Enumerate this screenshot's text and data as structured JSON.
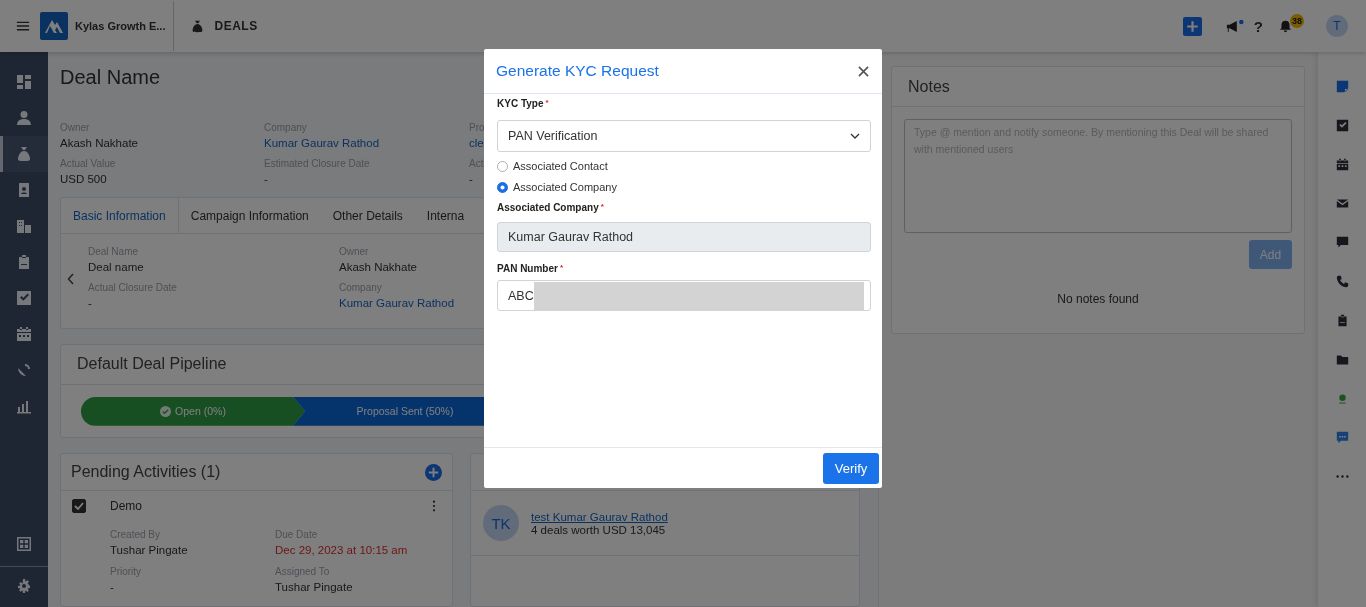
{
  "topbar": {
    "app_name": "Kylas Growth E...",
    "module": "DEALS",
    "announcement_unread": true,
    "help_label": "?",
    "notification_count": "38",
    "avatar_initial": "T"
  },
  "sidebar": {
    "items": [
      {
        "selected": false
      },
      {
        "selected": false
      },
      {
        "selected": true
      },
      {
        "selected": false
      },
      {
        "selected": false
      },
      {
        "selected": false
      },
      {
        "selected": false
      },
      {
        "selected": false
      },
      {
        "selected": false
      },
      {
        "selected": false
      }
    ]
  },
  "deal": {
    "title": "Deal Name",
    "fields": [
      {
        "label": "Owner",
        "value": "Akash Nakhate",
        "link": false
      },
      {
        "label": "Company",
        "value": "Kumar Gaurav Rathod",
        "link": true
      },
      {
        "label": "Pro",
        "value": "cle",
        "link": true
      },
      {
        "label": "Actual Value",
        "value": "USD 500",
        "link": false
      },
      {
        "label": "Estimated Closure Date",
        "value": "-",
        "link": false
      },
      {
        "label": "Act",
        "value": "-",
        "link": false
      }
    ]
  },
  "details": {
    "tabs": [
      {
        "label": "Basic Information",
        "selected": true
      },
      {
        "label": "Campaign Information",
        "selected": false
      },
      {
        "label": "Other Details",
        "selected": false
      },
      {
        "label": "Interna",
        "selected": false
      }
    ],
    "fields": [
      {
        "label": "Deal Name",
        "value": "Deal name",
        "link": false
      },
      {
        "label": "Owner",
        "value": "Akash Nakhate",
        "link": false
      },
      {
        "label": "Actual Closure Date",
        "value": "-",
        "link": false
      },
      {
        "label": "Company",
        "value": "Kumar Gaurav Rathod",
        "link": true
      }
    ]
  },
  "pipeline": {
    "title": "Default Deal Pipeline",
    "stages": [
      {
        "label": "Open (0%)",
        "done": true
      },
      {
        "label": "Proposal Sent (50%)",
        "done": false
      }
    ]
  },
  "activities": {
    "title": "Pending Activities (1)",
    "items": [
      {
        "title": "Demo",
        "checked": true,
        "fields": [
          {
            "label": "Created By",
            "value": "Tushar Pingate",
            "overdue": false
          },
          {
            "label": "Due Date",
            "value": "Dec 29, 2023 at 10:15 am",
            "overdue": true
          },
          {
            "label": "Priority",
            "value": "-",
            "overdue": false
          },
          {
            "label": "Assigned To",
            "value": "Tushar Pingate",
            "overdue": false
          }
        ]
      }
    ]
  },
  "contacts_card": {
    "items": [
      {
        "initials": "TK",
        "name": "test Kumar Gaurav Rathod",
        "summary": "4 deals worth USD 13,045"
      }
    ]
  },
  "notes": {
    "title": "Notes",
    "placeholder": "Type @ mention and notify someone. By mentioning this Deal will be shared with mentioned users",
    "add_label": "Add",
    "add_disabled": true,
    "empty_text": "No notes found"
  },
  "rail": {
    "items": [
      {
        "selected": true
      },
      {
        "selected": false
      },
      {
        "selected": false
      },
      {
        "selected": false
      },
      {
        "selected": false
      },
      {
        "selected": false
      },
      {
        "selected": false
      },
      {
        "selected": false
      }
    ]
  },
  "modal": {
    "title": "Generate KYC Request",
    "kyc_type": {
      "label": "KYC Type",
      "required_mark": "*",
      "value": "PAN Verification"
    },
    "options": [
      {
        "label": "Associated Contact",
        "selected": false
      },
      {
        "label": "Associated Company",
        "selected": true
      }
    ],
    "company": {
      "label": "Associated Company",
      "required_mark": "*",
      "value": "Kumar Gaurav Rathod",
      "disabled": true
    },
    "pan": {
      "label": "PAN Number",
      "required_mark": "*",
      "value": "ABC"
    },
    "verify_label": "Verify"
  }
}
